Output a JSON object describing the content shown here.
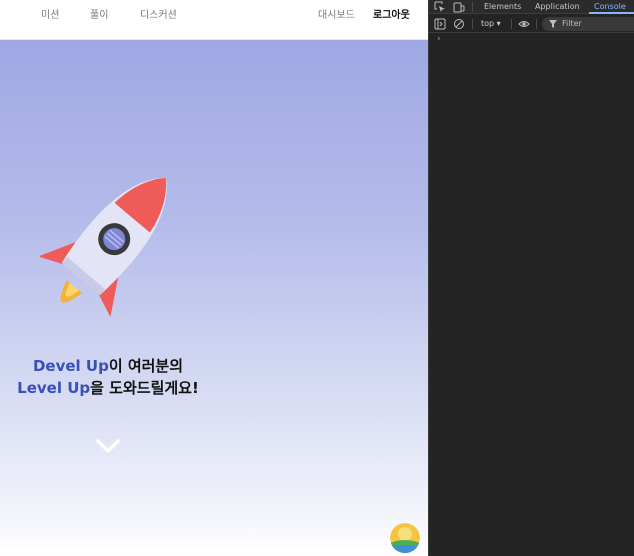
{
  "nav": {
    "mission": "미션",
    "solve": "풀이",
    "discussion": "디스커션",
    "dashboard": "대시보드",
    "logout": "로그아웃"
  },
  "hero": {
    "line1_accent": "Devel Up",
    "line1_rest": "이 여러분의",
    "line2_accent": "Level Up",
    "line2_rest": "을 도와드릴게요!"
  },
  "devtools": {
    "tabs": [
      "Elements",
      "Application",
      "Console"
    ],
    "active_tab": "Console",
    "context": "top",
    "filter_placeholder": "Filter",
    "prompt": "›"
  },
  "colors": {
    "accent": "#3a4fb8",
    "devtools_active": "#8ab4f8",
    "rocket_body": "#dfe1f5",
    "rocket_fin": "#ef5b57"
  },
  "icons": [
    "rocket-illustration",
    "chevron-down-icon",
    "avatar",
    "inspect-icon",
    "device-toolbar-icon",
    "sidebar-icon",
    "clear-console-icon",
    "eye-icon",
    "filter-icon"
  ]
}
